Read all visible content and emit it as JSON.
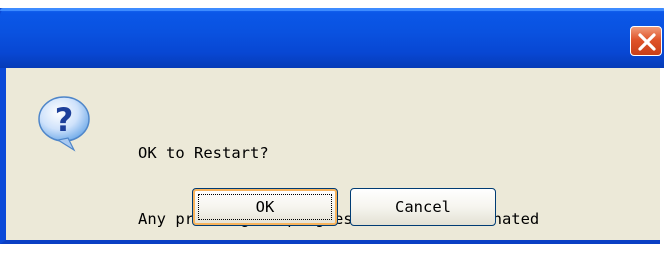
{
  "dialog": {
    "close_icon": "close-icon",
    "question_icon": "question-icon",
    "message_line1": "OK to Restart?",
    "message_line2": "Any printing in progress will be terminated",
    "ok_label": "OK",
    "cancel_label": "Cancel"
  },
  "colors": {
    "titlebar": "#0a52e0",
    "dialog_bg": "#ece9d8",
    "close_button": "#e0542a",
    "icon_bubble": "#6ba8e8"
  }
}
